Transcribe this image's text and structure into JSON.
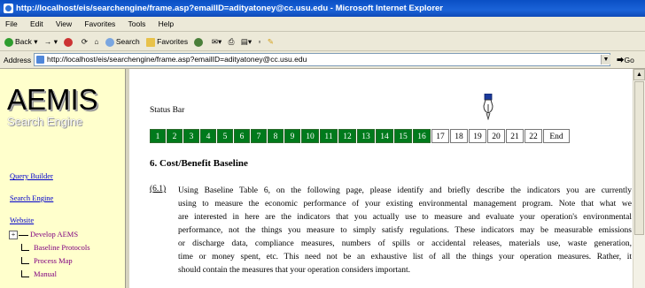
{
  "window": {
    "title": "http://localhost/eis/searchengine/frame.asp?emailID=adityatoney@cc.usu.edu - Microsoft Internet Explorer"
  },
  "menubar": {
    "items": [
      "File",
      "Edit",
      "View",
      "Favorites",
      "Tools",
      "Help"
    ]
  },
  "toolbar": {
    "back_label": "Back",
    "search_label": "Search",
    "favorites_label": "Favorites"
  },
  "address": {
    "label": "Address",
    "value": "http://localhost/eis/searchengine/frame.asp?emailID=adityatoney@cc.usu.edu",
    "go_label": "Go"
  },
  "sidebar": {
    "logo_main": "AEMIS",
    "logo_sub": "Search Engine",
    "links": [
      "Query Builder",
      "Search Engine",
      "Website"
    ],
    "tree": {
      "root_toggle": "+",
      "root_label": "Develop AEMS",
      "children": [
        "Baseline Protocols",
        "Process Map",
        "Manual"
      ]
    }
  },
  "main": {
    "status_label": "Status Bar",
    "status_cells": [
      "1",
      "2",
      "3",
      "4",
      "5",
      "6",
      "7",
      "8",
      "9",
      "10",
      "11",
      "12",
      "13",
      "14",
      "15",
      "16",
      "17",
      "18",
      "19",
      "20",
      "21",
      "22",
      "End"
    ],
    "completed_steps": 16,
    "section_heading": "6. Cost/Benefit Baseline",
    "para_num": "(6.1)",
    "para_lines": [
      "Using Baseline Table 6, on the following page, please identify and briefly describe the indicators you are currently",
      "using to measure the economic performance of your existing environmental management program. Note that what we",
      "are interested in here are the indicators that you actually use to measure and evaluate your operation's environmental",
      "performance, not the things you measure to simply satisfy regulations. These indicators may be measurable emissions",
      "or discharge data, compliance measures, numbers of spills or accidental releases, materials use, waste generation,",
      "time or money spent, etc. This need not be an exhaustive list of all the things your operation measures. Rather, it",
      "should contain the measures that your operation considers important."
    ]
  },
  "colors": {
    "titlebar": "#0a4fc4",
    "sidebar_bg": "#ffffcc",
    "done_cell": "#007a1c",
    "link": "#0000cc",
    "tree_child": "#800080"
  }
}
